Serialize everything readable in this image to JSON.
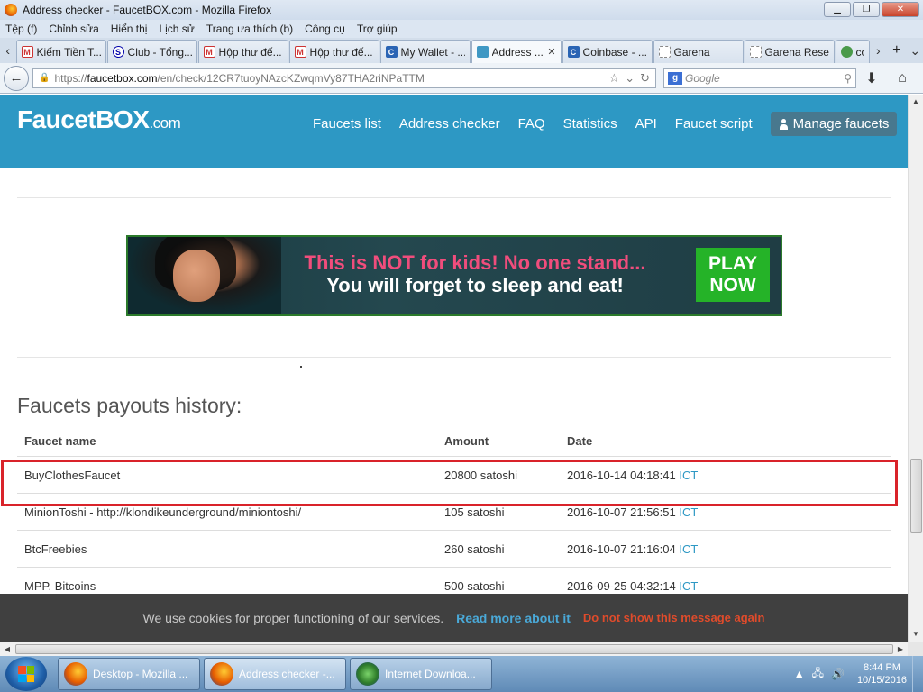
{
  "window": {
    "title": "Address checker - FaucetBOX.com - Mozilla Firefox",
    "btn_min": "▁",
    "btn_max": "❐",
    "btn_close": "✕"
  },
  "menu": [
    "Tệp (f)",
    "Chỉnh sửa",
    "Hiển thị",
    "Lịch sử",
    "Trang ưa thích (b)",
    "Công cụ",
    "Trợ giúp"
  ],
  "tabs": [
    {
      "label": "Kiếm Tiền T...",
      "icon": "gmail",
      "glyph": "M",
      "active": false
    },
    {
      "label": "Club - Tổng...",
      "icon": "skype",
      "glyph": "S",
      "active": false
    },
    {
      "label": "Hộp thư đế...",
      "icon": "gmail",
      "glyph": "M",
      "active": false
    },
    {
      "label": "Hộp thư đế...",
      "icon": "gmail",
      "glyph": "M",
      "active": false
    },
    {
      "label": "My Wallet - ...",
      "icon": "cb",
      "glyph": "C",
      "active": false
    },
    {
      "label": "Address ...",
      "icon": "fb",
      "glyph": "",
      "active": true
    },
    {
      "label": "Coinbase - ...",
      "icon": "cb",
      "glyph": "C",
      "active": false
    },
    {
      "label": "Garena",
      "icon": "dot",
      "glyph": "",
      "active": false
    },
    {
      "label": "Garena Rese...",
      "icon": "dot",
      "glyph": "",
      "active": false
    },
    {
      "label": "co",
      "icon": "leaf",
      "glyph": "",
      "active": false
    }
  ],
  "tabbar": {
    "left": "‹",
    "right": "›",
    "plus": "+",
    "dropdown": "⌄",
    "close": "✕"
  },
  "nav": {
    "back": "←",
    "url_scheme": "https://",
    "url_domain": "faucetbox.com",
    "url_path": "/en/check/12CR7tuoyNAzcKZwqmVy87THA2riNPaTTM",
    "star": "☆",
    "dropdown": "⌄",
    "reload": "↻",
    "search_engine": "g",
    "search_placeholder": "Google",
    "search_icon": "⚲",
    "download": "⬇",
    "home": "⌂"
  },
  "site": {
    "logo_main": "FaucetBOX",
    "logo_suffix": ".com",
    "nav": [
      "Faucets list",
      "Address checker",
      "FAQ",
      "Statistics",
      "API",
      "Faucet script"
    ],
    "manage_label": "Manage faucets"
  },
  "ad": {
    "line1": "This is NOT for kids! No one stand...",
    "line2": "You will forget to sleep and eat!",
    "cta_line1": "PLAY",
    "cta_line2": "NOW"
  },
  "history": {
    "title": "Faucets payouts history:",
    "columns": [
      "Faucet name",
      "Amount",
      "Date"
    ],
    "rows": [
      {
        "name": "BuyClothesFaucet",
        "amount": "20800 satoshi",
        "date": "2016-10-14 04:18:41",
        "tz": "ICT"
      },
      {
        "name": "MinionToshi - http://klondikeunderground/miniontoshi/",
        "amount": "105 satoshi",
        "date": "2016-10-07 21:56:51",
        "tz": "ICT"
      },
      {
        "name": "BtcFreebies",
        "amount": "260 satoshi",
        "date": "2016-10-07 21:16:04",
        "tz": "ICT"
      },
      {
        "name": "MPP. Bitcoins",
        "amount": "500 satoshi",
        "date": "2016-09-25 04:32:14",
        "tz": "ICT"
      }
    ]
  },
  "cookie": {
    "message": "We use cookies for proper functioning of our services.",
    "more": "Read more about it",
    "dismiss": "Do not show this message again"
  },
  "scroll": {
    "up": "▲",
    "down": "▼",
    "left": "◀",
    "right": "▶"
  },
  "taskbar": {
    "items": [
      {
        "label": "Desktop - Mozilla ...",
        "icon": "firefox",
        "active": false
      },
      {
        "label": "Address checker -...",
        "icon": "firefox",
        "active": true
      },
      {
        "label": "Internet Downloa...",
        "icon": "idm",
        "active": false
      }
    ],
    "tray_up": "▲",
    "tray_network": "🖧",
    "tray_volume": "🔊",
    "time": "8:44 PM",
    "date": "10/15/2016"
  }
}
